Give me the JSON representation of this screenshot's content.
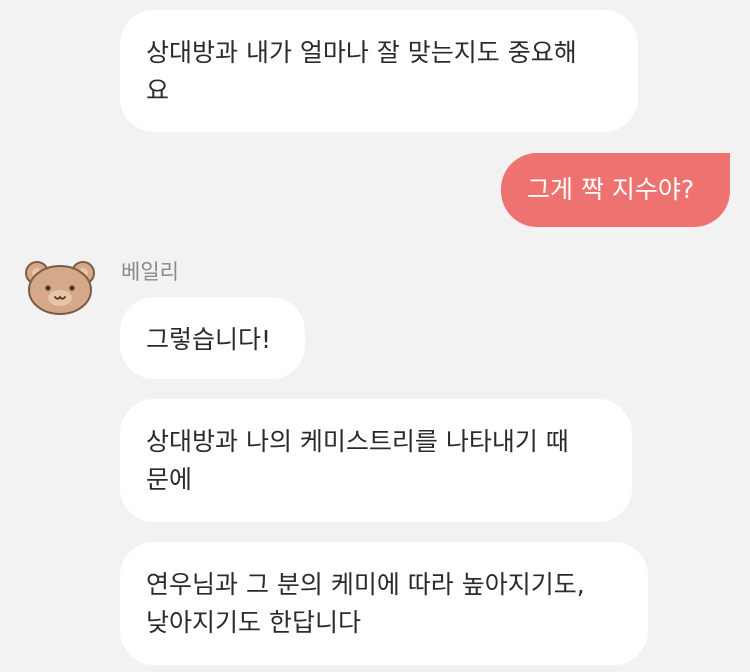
{
  "conversation": {
    "sender_name": "베일리",
    "messages": [
      {
        "text": "상대방과 내가 얼마나 잘 맞는지도 중요해\n요"
      },
      {
        "text": "그게 짝 지수야?"
      },
      {
        "text": "그렇습니다!"
      },
      {
        "text": "상대방과 나의 케미스트리를 나타내기 때\n문에"
      },
      {
        "text": "연우님과 그 분의 케미에 따라 높아지기도,\n낮아지기도 한답니다"
      }
    ]
  },
  "colors": {
    "background": "#f2f2f2",
    "incoming_bubble": "#ffffff",
    "outgoing_bubble": "#ee7370",
    "avatar": "#d4a98a"
  },
  "icons": {
    "avatar": "bear-face-icon"
  }
}
